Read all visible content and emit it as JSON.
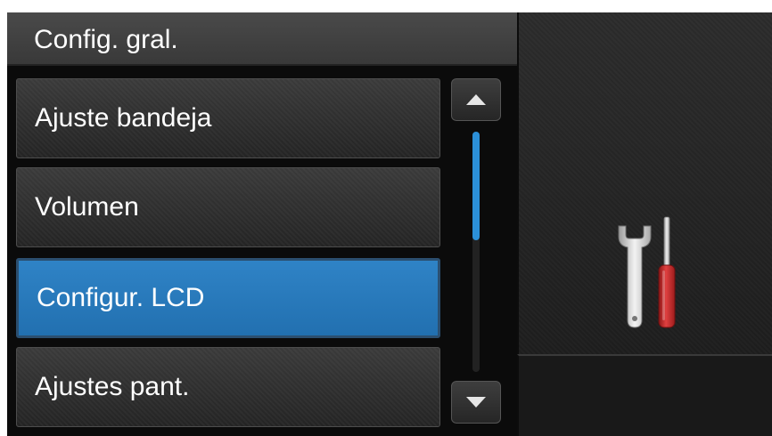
{
  "header": {
    "title": "Config. gral."
  },
  "menu": {
    "items": [
      {
        "label": "Ajuste bandeja",
        "selected": false
      },
      {
        "label": "Volumen",
        "selected": false
      },
      {
        "label": "Configur. LCD",
        "selected": true
      },
      {
        "label": "Ajustes pant.",
        "selected": false
      }
    ]
  },
  "scrollbar": {
    "position_fraction": 0.0,
    "visible_fraction": 0.45
  },
  "side_panel": {
    "icon": "wrench-screwdriver-icon"
  },
  "colors": {
    "accent": "#2b7fc1",
    "background": "#111111",
    "screwdriver": "#c62b2b",
    "text": "#ffffff"
  }
}
